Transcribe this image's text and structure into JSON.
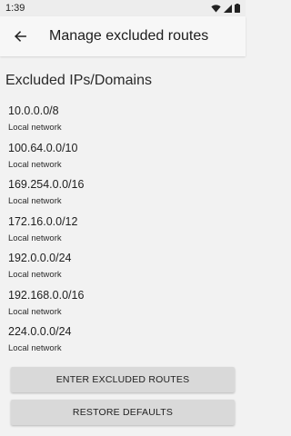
{
  "status_bar": {
    "time": "1:39"
  },
  "app_bar": {
    "title": "Manage excluded routes"
  },
  "section_title": "Excluded IPs/Domains",
  "routes": [
    {
      "ip": "10.0.0.0/8",
      "desc": "Local network"
    },
    {
      "ip": "100.64.0.0/10",
      "desc": "Local network"
    },
    {
      "ip": "169.254.0.0/16",
      "desc": "Local network"
    },
    {
      "ip": "172.16.0.0/12",
      "desc": "Local network"
    },
    {
      "ip": "192.0.0.0/24",
      "desc": "Local network"
    },
    {
      "ip": "192.168.0.0/16",
      "desc": "Local network"
    },
    {
      "ip": "224.0.0.0/24",
      "desc": "Local network"
    }
  ],
  "buttons": {
    "enter": "ENTER EXCLUDED ROUTES",
    "restore": "RESTORE DEFAULTS"
  }
}
